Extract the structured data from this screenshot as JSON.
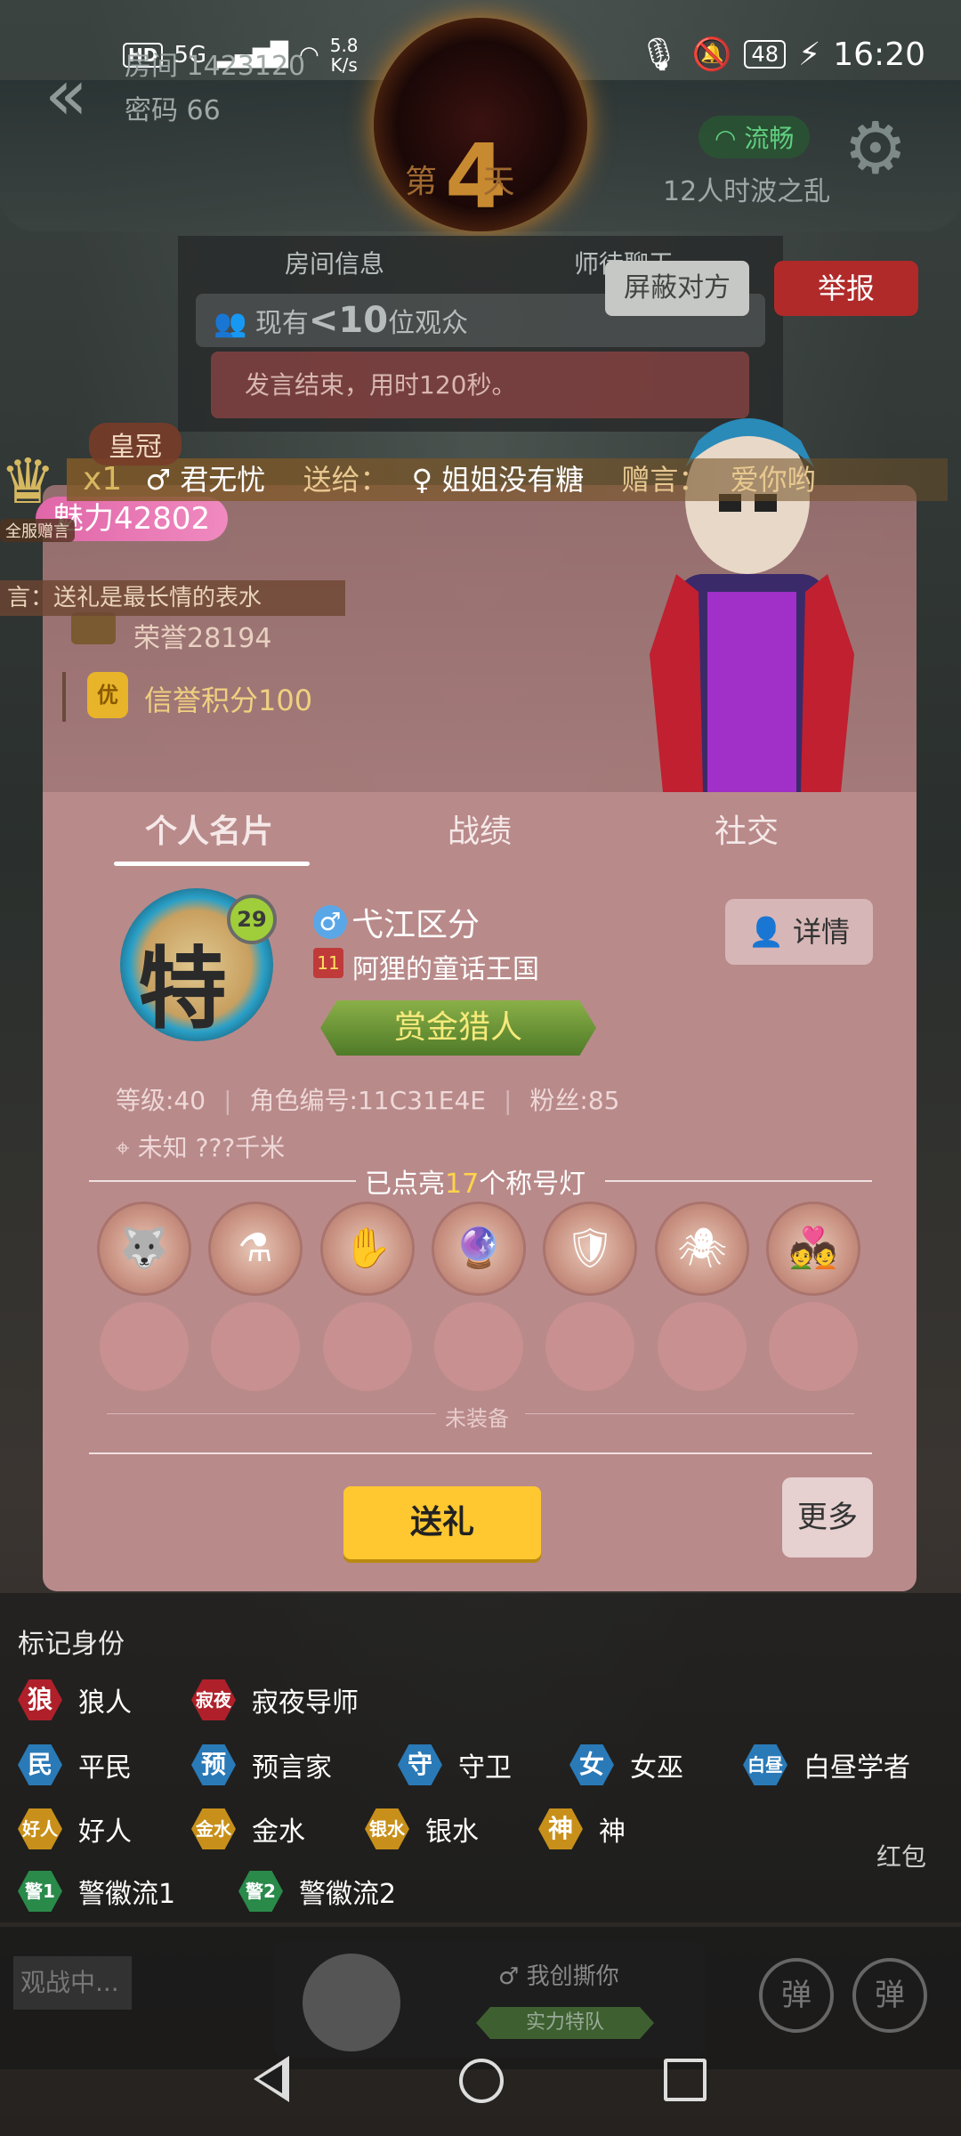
{
  "status_bar": {
    "hd": "HD",
    "network": "5G",
    "speed_value": "5.8",
    "speed_unit": "K/s",
    "battery": "48",
    "time": "16:20"
  },
  "header": {
    "room_label": "房间 1423120",
    "password_label": "密码 66",
    "day_prefix": "第",
    "day_number": "4",
    "day_suffix": "天",
    "network_status": "流畅",
    "mode": "12人时波之乱"
  },
  "room_panel": {
    "tab_room_info": "房间信息",
    "tab_chat": "师徒聊天",
    "viewers_prefix": "现有",
    "viewers_count": "<10",
    "viewers_suffix": "位观众",
    "speech_end": "发言结束，用时120秒。",
    "block_button": "屏蔽对方",
    "report_button": "举报"
  },
  "gift_banner": {
    "crown_tag": "皇冠",
    "server_gift": "全服赠言",
    "multiplier": "x1",
    "sender": "君无忧",
    "send_to": "送给：",
    "receiver": "姐姐没有糖",
    "message_label": "赠言：",
    "message": "爱你哟",
    "wish": "言：送礼是最长情的表水"
  },
  "profile_top": {
    "charm": "魅力42802",
    "honor": "荣誉28194",
    "credit_badge": "优",
    "credit": "信誉积分100"
  },
  "tabs": [
    "个人名片",
    "战绩",
    "社交"
  ],
  "profile": {
    "avatar_char": "特",
    "level_badge": "29",
    "gender": "♂",
    "username": "弋江区分",
    "guild_level": "11",
    "guild": "阿狸的童话王国",
    "title": "赏金猎人",
    "detail_button": "详情",
    "level": "等级:40",
    "role_id": "角色编号:11C31E4E",
    "fans": "粉丝:85",
    "location": "未知",
    "distance": "???千米"
  },
  "lights": {
    "prefix": "已点亮",
    "count": "17",
    "suffix": "个称号灯",
    "unequipped": "未装备"
  },
  "actions": {
    "gift": "送礼",
    "more": "更多"
  },
  "mark_identity": {
    "title": "标记身份",
    "items": [
      {
        "icon": "狼",
        "label": "狼人",
        "color": "#b0202a"
      },
      {
        "icon": "寂夜",
        "label": "寂夜导师",
        "color": "#b0202a"
      },
      {
        "icon": "民",
        "label": "平民",
        "color": "#2a7ab8"
      },
      {
        "icon": "预",
        "label": "预言家",
        "color": "#2a7ab8"
      },
      {
        "icon": "守",
        "label": "守卫",
        "color": "#2a7ab8"
      },
      {
        "icon": "女",
        "label": "女巫",
        "color": "#2a7ab8"
      },
      {
        "icon": "白昼",
        "label": "白昼学者",
        "color": "#2a7ab8"
      },
      {
        "icon": "好人",
        "label": "好人",
        "color": "#c8901a"
      },
      {
        "icon": "金水",
        "label": "金水",
        "color": "#c8901a"
      },
      {
        "icon": "银水",
        "label": "银水",
        "color": "#c8901a"
      },
      {
        "icon": "神",
        "label": "神",
        "color": "#c8901a"
      },
      {
        "icon": "警1",
        "label": "警徽流1",
        "color": "#2a8a4a"
      },
      {
        "icon": "警2",
        "label": "警徽流2",
        "color": "#2a8a4a"
      }
    ]
  },
  "bottom": {
    "watching": "观战中...",
    "player_name": "我创撕你",
    "team": "实力特队",
    "bullet_1": "弹",
    "bullet_2": "弹",
    "red_packet": "红包"
  }
}
